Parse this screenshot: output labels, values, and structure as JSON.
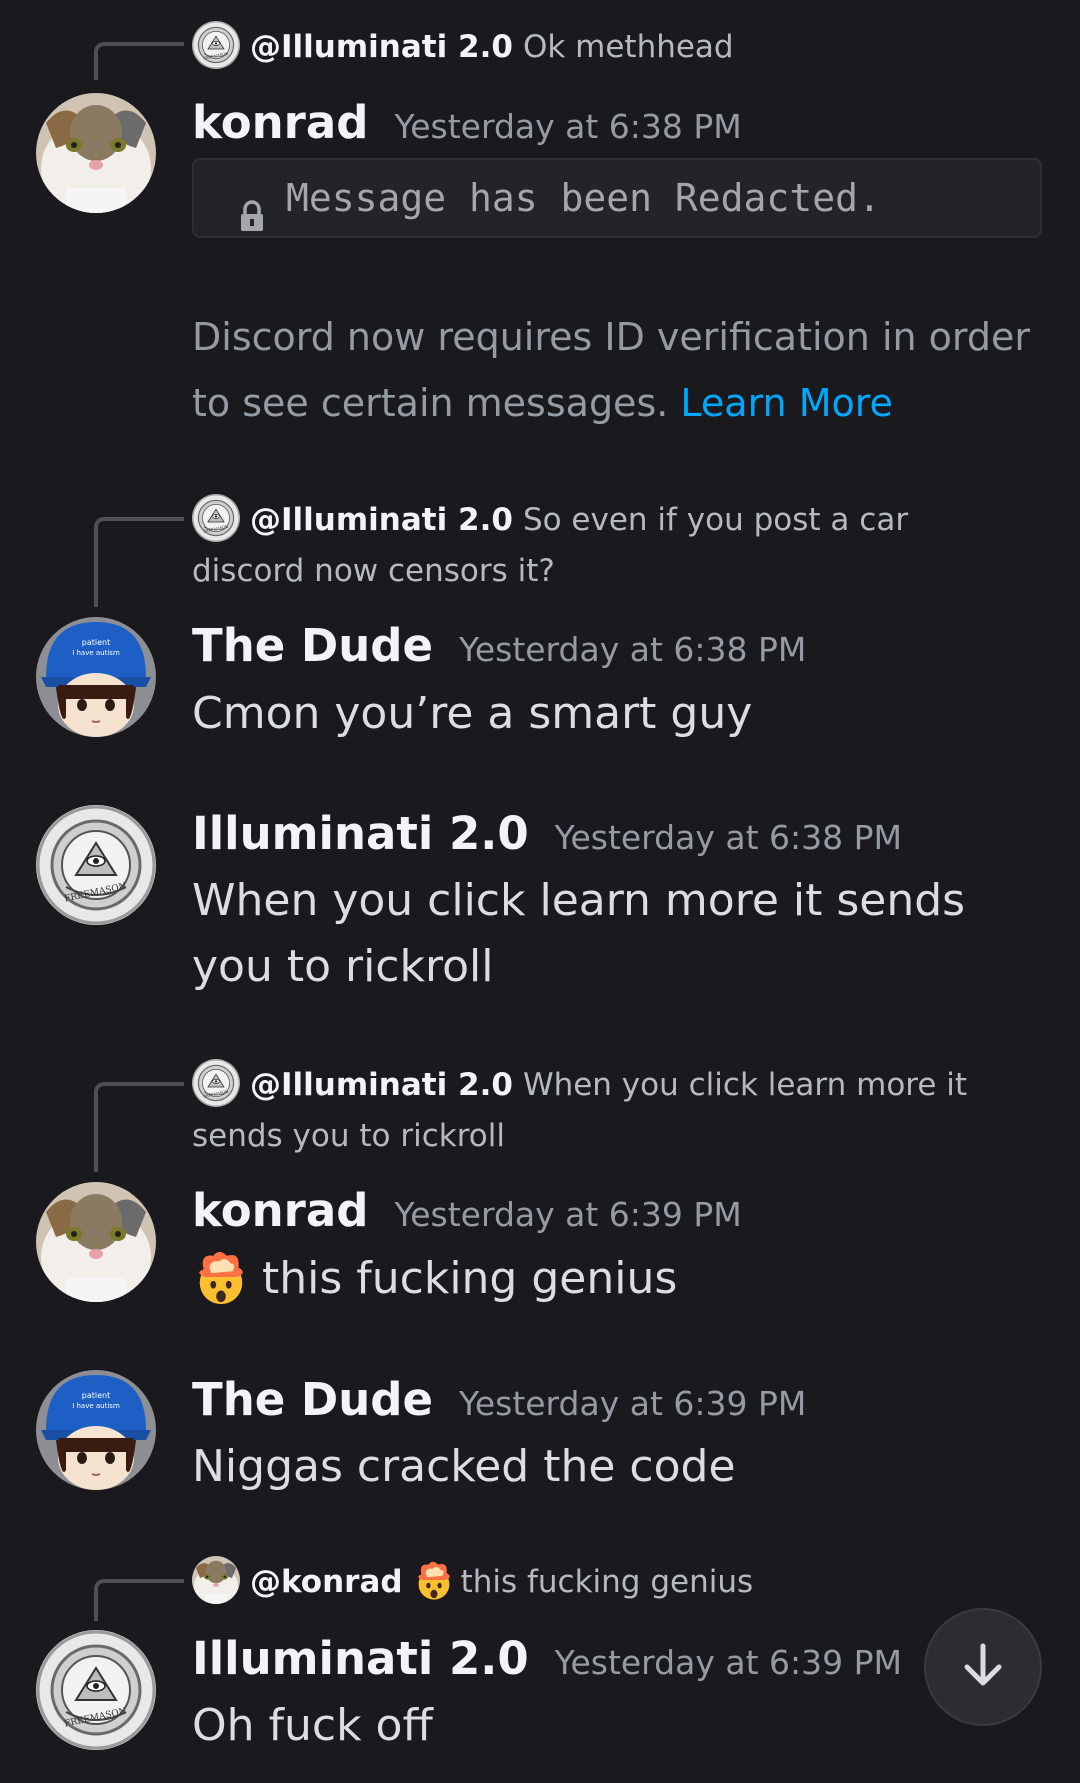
{
  "messages": [
    {
      "reply": {
        "name": "@Illuminati 2.0",
        "text": "Ok methhead"
      },
      "username": "konrad",
      "timestamp": "Yesterday at 6:38 PM",
      "redacted_text": "Message has been Redacted.",
      "notice_text": "Discord now requires ID verification in order to see certain messages.",
      "notice_link": "Learn More"
    },
    {
      "reply": {
        "name": "@Illuminati 2.0",
        "text": "So even if you post a car discord now censors it?"
      },
      "username": "The Dude",
      "timestamp": "Yesterday at 6:38 PM",
      "content": "Cmon you’re a smart guy"
    },
    {
      "username": "Illuminati 2.0",
      "timestamp": "Yesterday at 6:38 PM",
      "content": "When you click learn more it sends you to rickroll"
    },
    {
      "reply": {
        "name": "@Illuminati 2.0",
        "text": "When you click learn more it sends you to rickroll"
      },
      "username": "konrad",
      "timestamp": "Yesterday at 6:39 PM",
      "content": "this fucking genius",
      "emoji": "exploding-head-emoji"
    },
    {
      "username": "The Dude",
      "timestamp": "Yesterday at 6:39 PM",
      "content": "Niggas cracked the code"
    },
    {
      "reply": {
        "name": "@konrad",
        "text": "this fucking genius",
        "emoji": "exploding-head-emoji"
      },
      "username": "Illuminati 2.0",
      "timestamp": "Yesterday at 6:39 PM",
      "content": "Oh fuck off"
    }
  ],
  "scroll_button": {
    "icon": "arrow-down-icon"
  },
  "colors": {
    "background": "#1a1a1e",
    "link": "#00a8fc",
    "username": "#f2f3f5",
    "timestamp": "#949ba4"
  }
}
